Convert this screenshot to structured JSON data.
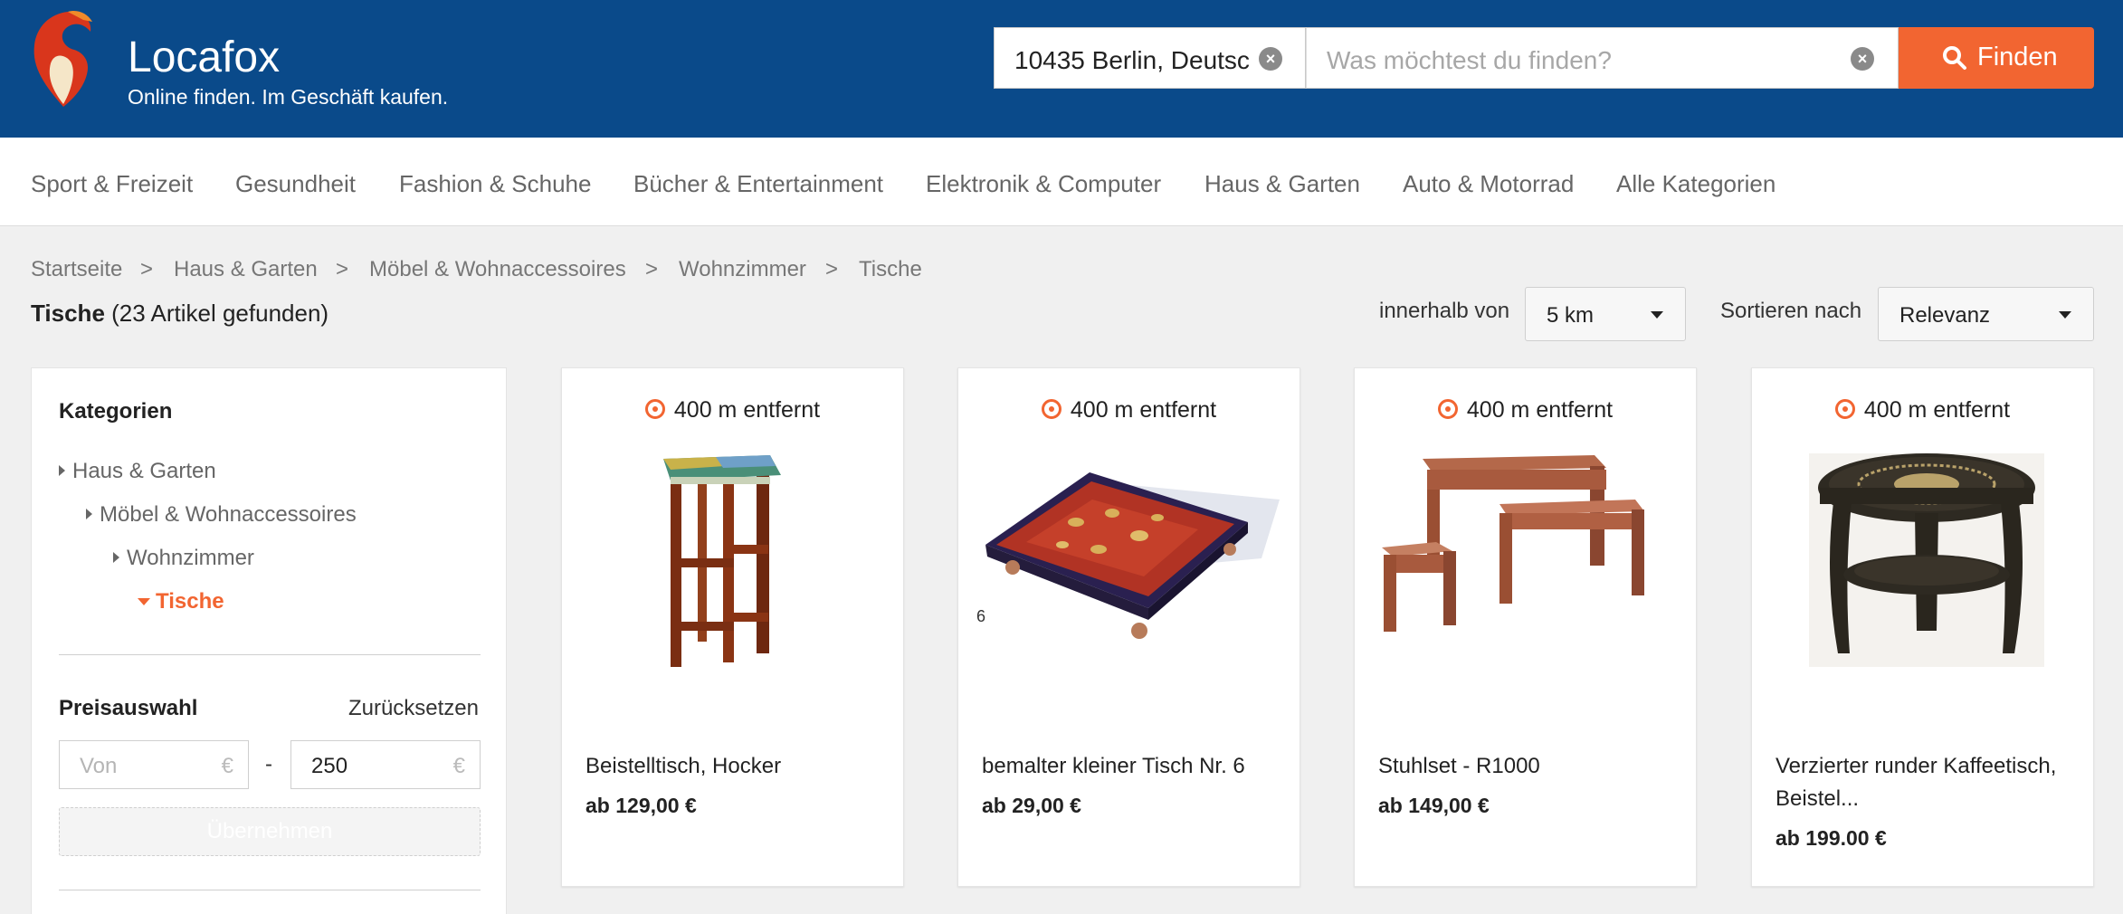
{
  "brand": {
    "name": "Locafox",
    "tagline": "Online finden. Im Geschäft kaufen."
  },
  "search": {
    "location_value": "10435 Berlin, Deutsc",
    "query_placeholder": "Was möchtest du finden?",
    "button_label": "Finden",
    "accent_color": "#f26531"
  },
  "nav": {
    "categories": [
      "Sport & Freizeit",
      "Gesundheit",
      "Fashion & Schuhe",
      "Bücher & Entertainment",
      "Elektronik & Computer",
      "Haus & Garten",
      "Auto & Motorrad",
      "Alle Kategorien"
    ]
  },
  "breadcrumb": {
    "items": [
      "Startseite",
      "Haus & Garten",
      "Möbel & Wohnaccessoires",
      "Wohnzimmer",
      "Tische"
    ],
    "separator": ">"
  },
  "results": {
    "category": "Tische",
    "count_text": "(23 Artikel gefunden)"
  },
  "filters": {
    "within_label": "innerhalb von",
    "within_value": "5 km",
    "sort_label": "Sortieren nach",
    "sort_value": "Relevanz"
  },
  "sidebar": {
    "heading": "Kategorien",
    "tree": [
      "Haus & Garten",
      "Möbel & Wohnaccessoires",
      "Wohnzimmer",
      "Tische"
    ],
    "price_heading": "Preisauswahl",
    "reset_label": "Zurücksetzen",
    "from_placeholder": "Von",
    "to_value": "250",
    "currency": "€",
    "dash": "-",
    "apply_label": "Übernehmen"
  },
  "products": [
    {
      "distance": "400 m entfernt",
      "name": "Beistelltisch, Hocker",
      "price": "ab 129,00 €",
      "image": "tall-wooden-stool"
    },
    {
      "distance": "400 m entfernt",
      "name": "bemalter kleiner Tisch Nr. 6",
      "price": "ab 29,00 €",
      "image": "painted-low-table",
      "image_label": "6"
    },
    {
      "distance": "400 m entfernt",
      "name": "Stuhlset - R1000",
      "price": "ab 149,00 €",
      "image": "nesting-table-set"
    },
    {
      "distance": "400 m entfernt",
      "name": "Verzierter runder Kaffeetisch, Beistel...",
      "price": "ab 199.00 €",
      "image": "round-ornate-table"
    }
  ]
}
